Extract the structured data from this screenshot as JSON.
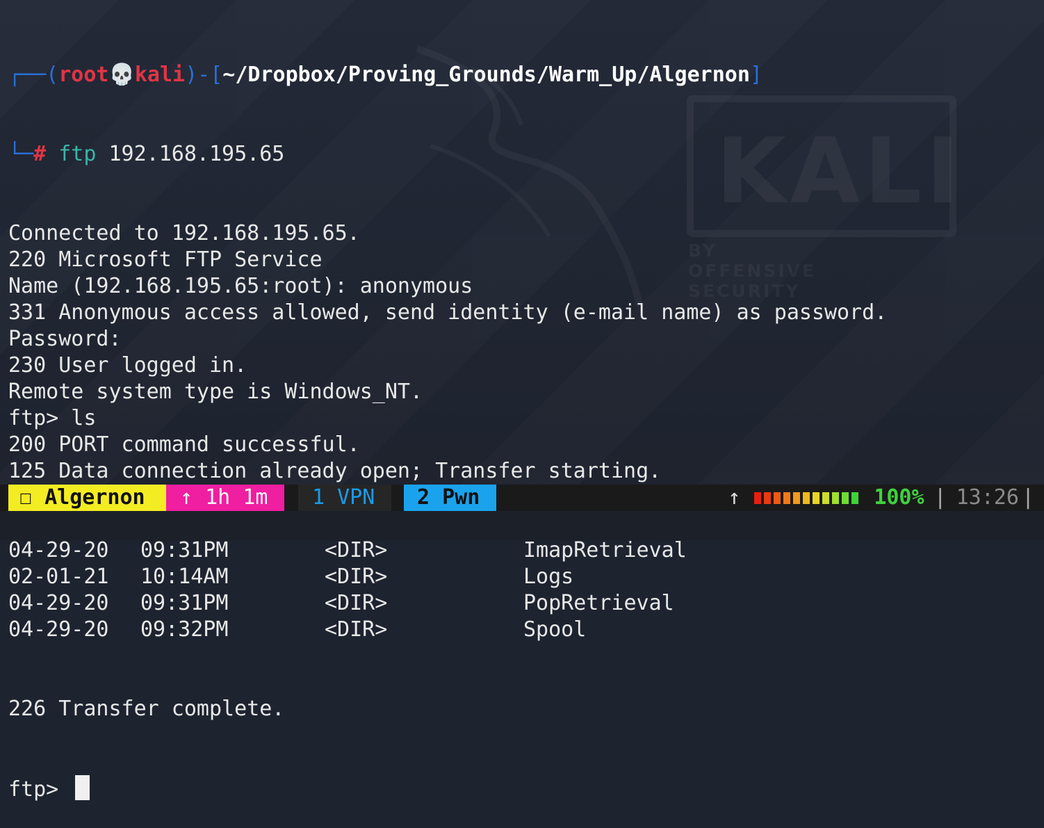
{
  "prompt": {
    "box_left": "┌──(",
    "user": "root",
    "skull": "💀",
    "host": "kali",
    "box_mid": ")-[",
    "cwd": "~/Dropbox/Proving_Grounds/Warm_Up/Algernon",
    "box_right": "]",
    "box_bottom": "└─",
    "hash": "#",
    "cmd": "ftp",
    "args": " 192.168.195.65"
  },
  "output": [
    "Connected to 192.168.195.65.",
    "220 Microsoft FTP Service",
    "Name (192.168.195.65:root): anonymous",
    "331 Anonymous access allowed, send identity (e-mail name) as password.",
    "Password:",
    "230 User logged in.",
    "Remote system type is Windows_NT.",
    "ftp> ls",
    "200 PORT command successful.",
    "125 Data connection already open; Transfer starting."
  ],
  "listing": [
    {
      "date": "04-29-20",
      "time": "09:31PM",
      "type": "<DIR>",
      "name": "ImapRetrieval"
    },
    {
      "date": "02-01-21",
      "time": "10:14AM",
      "type": "<DIR>",
      "name": "Logs"
    },
    {
      "date": "04-29-20",
      "time": "09:31PM",
      "type": "<DIR>",
      "name": "PopRetrieval"
    },
    {
      "date": "04-29-20",
      "time": "09:32PM",
      "type": "<DIR>",
      "name": "Spool"
    }
  ],
  "after": "226 Transfer complete.",
  "current_prompt": "ftp> ",
  "background": {
    "logo_word": "KALI",
    "logo_sub": "BY OFFENSIVE SECURITY"
  },
  "statusbar": {
    "session": "☐ Algernon",
    "uptime": "↑ 1h 1m",
    "window1": "1 VPN",
    "window2": "2 Pwn",
    "arrow": "↑",
    "battery_percent": "100%",
    "battery_level": 1.0,
    "separator": "|",
    "clock": "13:26",
    "trail": "|",
    "bar_colors": [
      "#e8200f",
      "#ec3a10",
      "#f05a14",
      "#f2791a",
      "#f29a1f",
      "#efb821",
      "#e8d424",
      "#c9df2a",
      "#9fe02e",
      "#6fdc31",
      "#3fd33a"
    ]
  }
}
